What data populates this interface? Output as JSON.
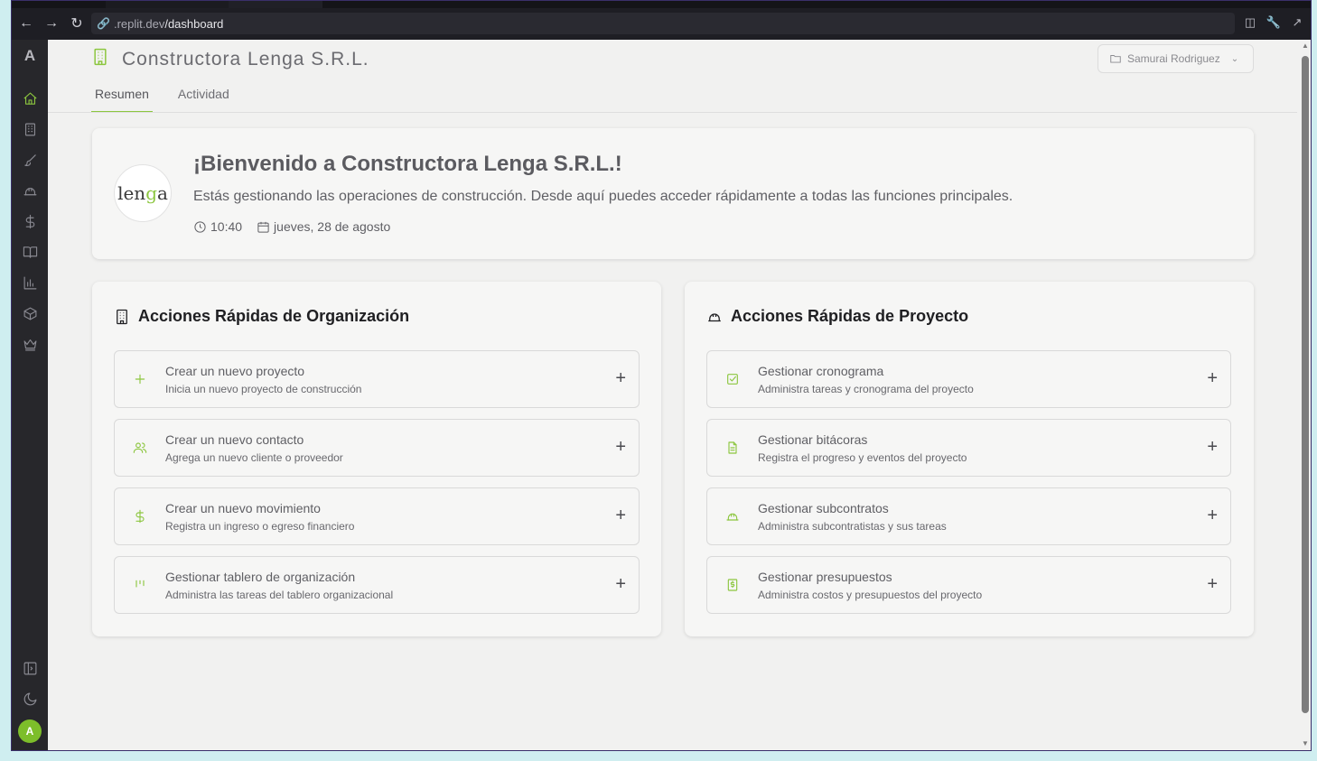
{
  "browser": {
    "url_host": ".replit.dev",
    "url_path": "/dashboard"
  },
  "rail": {
    "logo": "A",
    "avatar": "A",
    "icons": [
      "home-icon",
      "building-icon",
      "brush-icon",
      "helmet-icon",
      "dollar-icon",
      "book-icon",
      "bar-chart-icon",
      "package-icon",
      "crown-icon",
      "sidebar-toggle-icon",
      "moon-icon"
    ]
  },
  "header": {
    "org_name": "Constructora Lenga S.R.L.",
    "user": "Samurai Rodriguez"
  },
  "tabs": [
    "Resumen",
    "Actividad"
  ],
  "welcome": {
    "title": "¡Bienvenido a Constructora Lenga S.R.L.!",
    "description": "Estás gestionando las operaciones de construcción. Desde aquí puedes acceder rápidamente a todas las funciones principales.",
    "time": "10:40",
    "date": "jueves, 28 de agosto",
    "logo_text_a": "len",
    "logo_text_b": "g",
    "logo_text_c": "a"
  },
  "org_actions": {
    "title": "Acciones Rápidas de Organización",
    "items": [
      {
        "title": "Crear un nuevo proyecto",
        "subtitle": "Inicia un nuevo proyecto de construcción",
        "icon": "plus-icon"
      },
      {
        "title": "Crear un nuevo contacto",
        "subtitle": "Agrega un nuevo cliente o proveedor",
        "icon": "users-icon"
      },
      {
        "title": "Crear un nuevo movimiento",
        "subtitle": "Registra un ingreso o egreso financiero",
        "icon": "dollar-icon"
      },
      {
        "title": "Gestionar tablero de organización",
        "subtitle": "Administra las tareas del tablero organizacional",
        "icon": "kanban-icon"
      }
    ]
  },
  "project_actions": {
    "title": "Acciones Rápidas de Proyecto",
    "items": [
      {
        "title": "Gestionar cronograma",
        "subtitle": "Administra tareas y cronograma del proyecto",
        "icon": "check-square-icon"
      },
      {
        "title": "Gestionar bitácoras",
        "subtitle": "Registra el progreso y eventos del proyecto",
        "icon": "file-text-icon"
      },
      {
        "title": "Gestionar subcontratos",
        "subtitle": "Administra subcontratistas y sus tareas",
        "icon": "helmet-icon"
      },
      {
        "title": "Gestionar presupuestos",
        "subtitle": "Administra costos y presupuestos del proyecto",
        "icon": "receipt-icon"
      }
    ]
  },
  "colors": {
    "accent": "#8cc63f",
    "rail_bg": "#27272b",
    "page_bg": "#f1f1f0"
  }
}
